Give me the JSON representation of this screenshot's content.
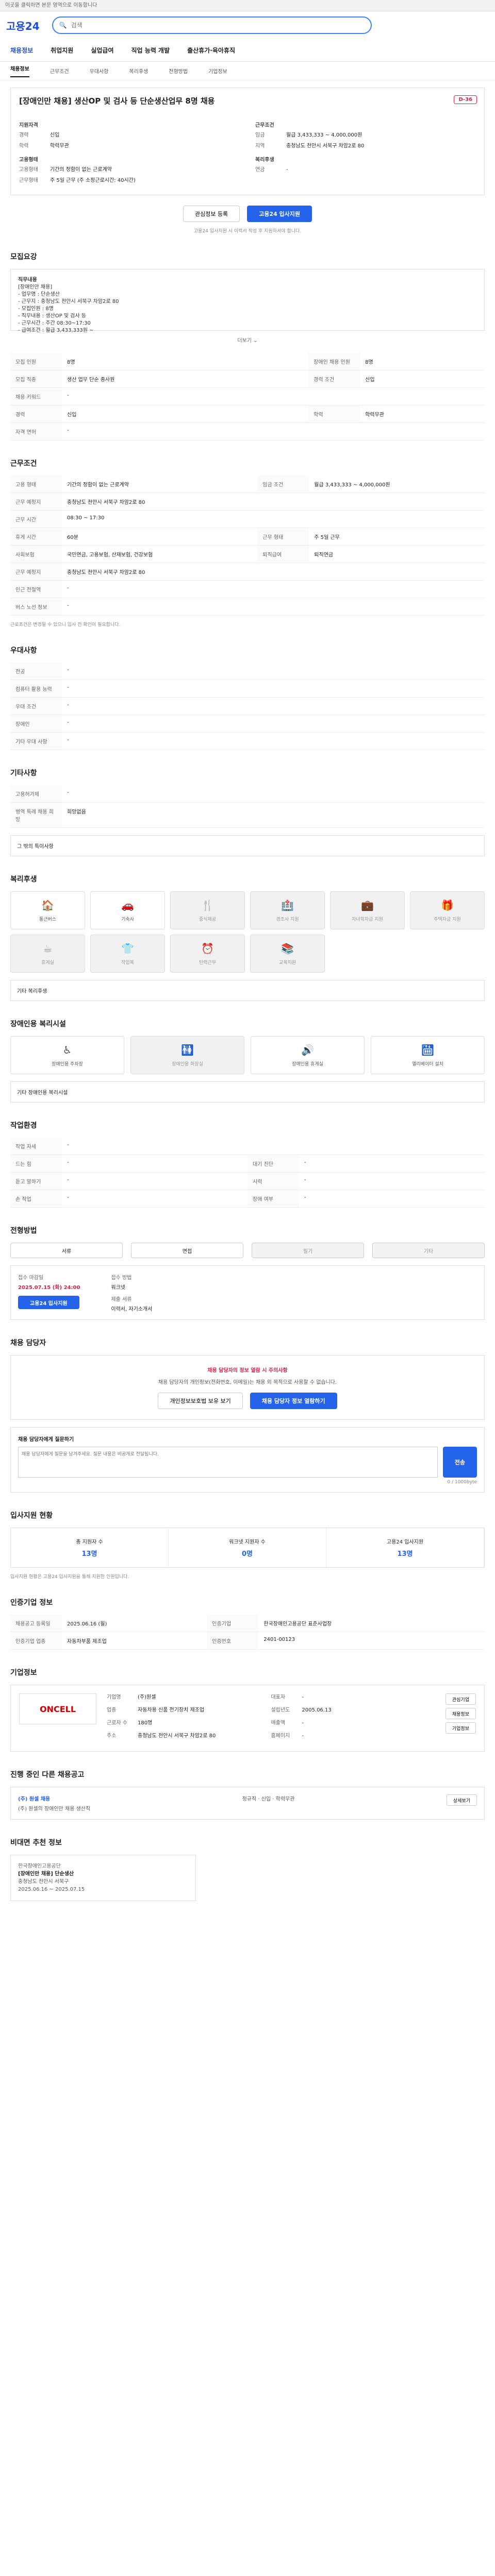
{
  "topbar": {
    "text": "이곳을 클릭하면 본문 영역으로 이동합니다"
  },
  "header": {
    "logo": "고용24",
    "search_placeholder": "검색"
  },
  "gnb": {
    "items": [
      "채용정보",
      "취업지원",
      "실업급여",
      "직업 능력 개발",
      "출산휴가·육아휴직"
    ]
  },
  "subnav": {
    "items": [
      "채용정보",
      "근무조건",
      "우대사항",
      "복리후생",
      "전형방법",
      "기업정보"
    ]
  },
  "job": {
    "title": "[장애인만 채용] 생산OP 및 검사 등 단순생산업무 8명 채용",
    "dday": "D-36",
    "left_group": "지원자격",
    "left": [
      {
        "k": "경력",
        "v": "신입"
      },
      {
        "k": "학력",
        "v": "학력무관"
      }
    ],
    "right_group": "근무조건",
    "right": [
      {
        "k": "임금",
        "v": "월급 3,433,333 ~ 4,000,000원"
      },
      {
        "k": "지역",
        "v": "충청남도 천안시 서북구 차암2로 80"
      }
    ],
    "form_group": "고용형태",
    "form": [
      {
        "k": "고용형태",
        "v": "기간의 정함이 없는 근로계약"
      },
      {
        "k": "근무형태",
        "v": "주 5일 근무 (주 소정근로시간: 40시간)"
      }
    ],
    "welfare_group": "복리후생",
    "welfare": [
      {
        "k": "연금",
        "v": "-"
      }
    ]
  },
  "buttons": {
    "scrap": "관심정보 등록",
    "apply": "고용24 입사지원"
  },
  "note": "고용24 입사지원 시 이력서 작성 후 지원하셔야 합니다.",
  "sections": {
    "recruit": "모집요강",
    "conditions": "근무조건",
    "preference": "우대사항",
    "other": "기타사항",
    "welfare": "복리후생",
    "disabled": "장애인용 복리시설",
    "process": "전형방법",
    "manager": "채용 담당자",
    "stats": "입사지원 현황",
    "company_info": "인증기업 정보",
    "company": "기업정보",
    "other_jobs": "진행 중인 다른 채용공고",
    "similar": "비대면 추천 정보"
  },
  "recruit_detail": [
    "직무내용",
    "[장애인만 채용]",
    "- 업무명 : 단순생산",
    "- 근무지 : 충청남도 천안시 서북구 차암2로 80",
    "- 모집인원 : 8명",
    "- 직무내용 : 생산OP 및 검사 등",
    "- 근무시간 : 주간 08:30~17:30",
    "- 급여조건 : 월급 3,433,333원 ~",
    "- 근무형태 : 주 5일 근무",
    "- 문의 : 041-521-4544",
    "- 우대사항 : 천안시 거주자",
    "- 기타 : 4대보험"
  ],
  "more_label": "더보기 ⌄",
  "recruit_table": [
    {
      "k1": "모집 인원",
      "v1": "8명",
      "k2": "장애인 채용 인원",
      "v2": "8명"
    },
    {
      "k1": "모집 직종",
      "v1": "생산 업무 단순 종사원",
      "k2": "경력 조건",
      "v2": "신입"
    },
    {
      "k1": "채용 키워드",
      "v1": "-",
      "k2": "",
      "v2": ""
    },
    {
      "k1": "경력",
      "v1": "신입",
      "k2": "학력",
      "v2": "학력무관"
    },
    {
      "k1": "자격 면허",
      "v1": "-",
      "k2": "",
      "v2": ""
    }
  ],
  "cond_table": [
    {
      "k1": "고용 형태",
      "v1": "기간의 정함이 없는 근로계약",
      "k2": "임금 조건",
      "v2": "월급 3,433,333 ~ 4,000,000원"
    },
    {
      "k1": "근무 예정지",
      "v1": "충청남도 천안시 서북구 차암2로 80",
      "k2": "",
      "v2": ""
    },
    {
      "k1": "근무 시간",
      "v1": "08:30 ~ 17:30",
      "k2": "",
      "v2": ""
    },
    {
      "k1": "휴게 시간",
      "v1": "60분",
      "k2": "근무 형태",
      "v2": "주 5일 근무"
    },
    {
      "k1": "사회보험",
      "v1": "국민연금, 고용보험, 산재보험, 건강보험",
      "k2": "퇴직급여",
      "v2": "퇴직연금"
    },
    {
      "k1": "근무 예정지",
      "v1": "충청남도 천안시 서북구 차암2로 80",
      "k2": "",
      "v2": ""
    },
    {
      "k1": "인근 전철역",
      "v1": "-",
      "k2": "",
      "v2": ""
    },
    {
      "k1": "버스 노선 정보",
      "v1": "-",
      "k2": "",
      "v2": ""
    }
  ],
  "cond_note": "근로조건은 변경될 수 있으니 입사 전 확인이 필요합니다.",
  "pref_table": [
    {
      "k": "전공",
      "v": "-"
    },
    {
      "k": "컴퓨터 활용 능력",
      "v": "-"
    },
    {
      "k": "우대 조건",
      "v": "-"
    },
    {
      "k": "장애인",
      "v": "-"
    },
    {
      "k": "기타 우대 사항",
      "v": "-"
    }
  ],
  "other_table": [
    {
      "k": "고용허가제",
      "v": "-"
    },
    {
      "k": "병역 특례 채용 희망",
      "v": "희망없음"
    }
  ],
  "other_note_label": "그 밖의 특이사항",
  "welfare_cards": [
    {
      "icon": "🏠",
      "label": "통근버스",
      "dim": false
    },
    {
      "icon": "🚗",
      "label": "기숙사",
      "dim": false
    },
    {
      "icon": "🍴",
      "label": "중식제공",
      "dim": true
    },
    {
      "icon": "🏥",
      "label": "경조사 지원",
      "dim": true
    },
    {
      "icon": "💼",
      "label": "자녀학자금 지원",
      "dim": true
    },
    {
      "icon": "🎁",
      "label": "주택자금 지원",
      "dim": true
    },
    {
      "icon": "☕",
      "label": "휴게실",
      "dim": true
    },
    {
      "icon": "👕",
      "label": "작업복",
      "dim": true
    },
    {
      "icon": "⏰",
      "label": "탄력근무",
      "dim": true
    },
    {
      "icon": "📚",
      "label": "교육지원",
      "dim": true
    }
  ],
  "welfare_other_label": "기타 복리후생",
  "disabled_cards": [
    {
      "icon": "♿",
      "label": "장애인용 주차장",
      "dim": false
    },
    {
      "icon": "🚻",
      "label": "장애인용 화장실",
      "dim": true
    },
    {
      "icon": "🔊",
      "label": "장애인용 휴게실",
      "dim": false
    },
    {
      "icon": "🛗",
      "label": "엘리베이터 설치",
      "dim": false
    }
  ],
  "disabled_other_label": "기타 장애인용 복리시설",
  "worktable": [
    {
      "k1": "작업 자세",
      "v1": "-",
      "k2": "",
      "v2": ""
    },
    {
      "k1": "드는 힘",
      "v1": "-",
      "k2": "대기 진단",
      "v2": "-"
    },
    {
      "k1": "듣고 말하기",
      "v1": "-",
      "k2": "시력",
      "v2": "-"
    },
    {
      "k1": "손 작업",
      "v1": "-",
      "k2": "장애 여부",
      "v2": "-"
    }
  ],
  "process_tabs": [
    {
      "label": "서류",
      "dim": false
    },
    {
      "label": "면접",
      "dim": false
    },
    {
      "label": "필기",
      "dim": true
    },
    {
      "label": "기타",
      "dim": true
    }
  ],
  "apply": {
    "deadline_label": "접수 마감일",
    "deadline": "2025.07.15 (화) 24:00",
    "method_label": "접수 방법",
    "method": "워크넷",
    "docs_label": "제출 서류",
    "docs": "이력서, 자기소개서",
    "apply_button": "고용24 입사지원"
  },
  "manager": {
    "notice": "채용 담당자의 정보 열람 시 주의사항",
    "desc": "채용 담당자의 개인정보(전화번호, 이메일)는 채용 외 목적으로 사용할 수 없습니다.",
    "btn_call": "개인정보보호법 보유 보기",
    "btn_view": "채용 담당자 정보 열람하기"
  },
  "qa": {
    "label": "채용 담당자에게 질문하기",
    "placeholder": "채용 담당자에게 질문을 남겨주세요. 질문 내용은 비공개로 전달됩니다.",
    "counter": "0 / 1000byte",
    "submit": "전송"
  },
  "stats": [
    {
      "label": "총 지원자 수",
      "value": "13명"
    },
    {
      "label": "워크넷 지원자 수",
      "value": "0명"
    },
    {
      "label": "고용24 입사지원",
      "value": "13명"
    }
  ],
  "stats_note": "입사지원 현황은 고용24 입사지원을 통해 지원한 인원입니다.",
  "cert": [
    {
      "k1": "채용공고 등록일",
      "v1": "2025.06.16 (월)",
      "k2": "인증기업",
      "v2": "한국장애인고용공단 표준사업장"
    },
    {
      "k1": "인증기업 업종",
      "v1": "자동차부품 제조업",
      "k2": "인증번호",
      "v2": "2401-00123"
    }
  ],
  "company": {
    "logo": "ONCELL",
    "rows": [
      {
        "k": "기업명",
        "v": "(주)원셀"
      },
      {
        "k": "대표자",
        "v": "-"
      },
      {
        "k": "업종",
        "v": "자동차용 신품 전기장치 제조업"
      },
      {
        "k": "설립년도",
        "v": "2005.06.13"
      },
      {
        "k": "근로자 수",
        "v": "180명"
      },
      {
        "k": "매출액",
        "v": "-"
      },
      {
        "k": "주소",
        "v": "충청남도 천안시 서북구 차암2로 80"
      },
      {
        "k": "홈페이지",
        "v": "-"
      }
    ],
    "btn1": "관심기업",
    "btn2": "채용정보",
    "btn3": "기업정보"
  },
  "other_job": {
    "title": "(주) 원셀 채용",
    "sub": "(주) 원셀의 장애인만 채용 생산직",
    "right": "정규직 · 신입 · 학력무관",
    "btn": "상세보기"
  },
  "similar_job": {
    "company": "한국장애인고용공단",
    "title": "[장애인만 채용] 단순생산",
    "meta": "충청남도 천안시 서북구",
    "date": "2025.06.16 ~ 2025.07.15"
  }
}
